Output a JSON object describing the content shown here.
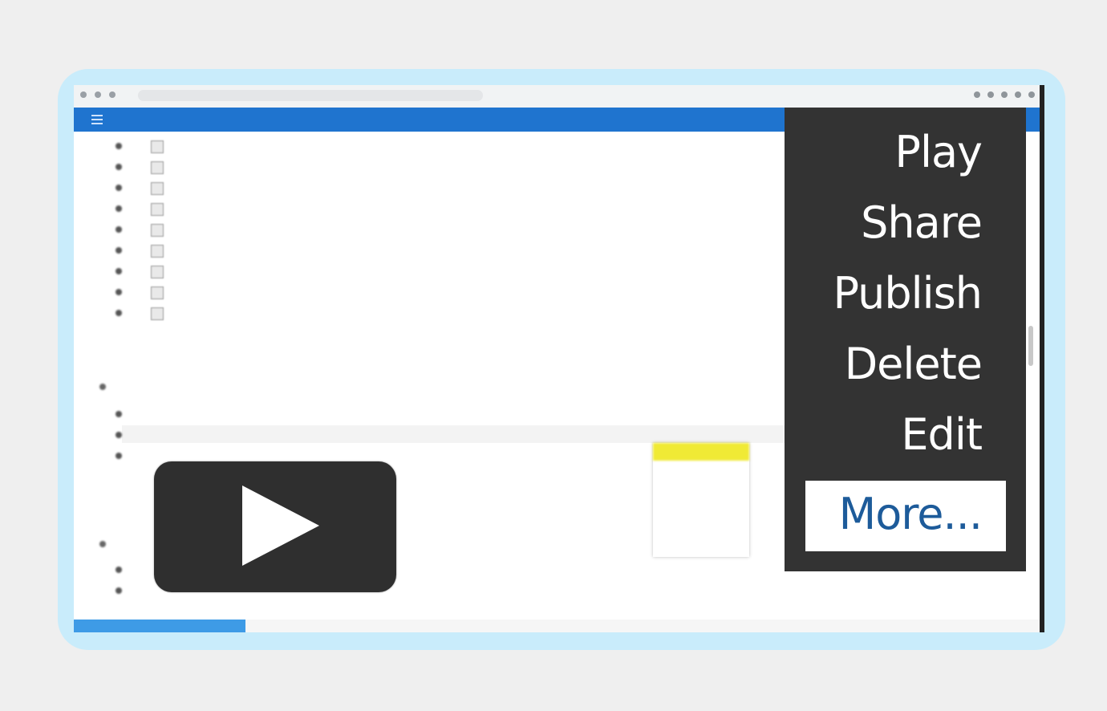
{
  "menu": {
    "items": [
      "Play",
      "Share",
      "Publish",
      "Delete",
      "Edit"
    ],
    "more": "More..."
  },
  "colors": {
    "frame": "#c9ecfb",
    "app_bar": "#1f74cf",
    "menu_bg": "#333333",
    "more_text": "#1d5b9a",
    "dropdown_highlight": "#f0ea35"
  },
  "icons": {
    "play": "play-icon",
    "menu": "hamburger-menu-icon"
  }
}
